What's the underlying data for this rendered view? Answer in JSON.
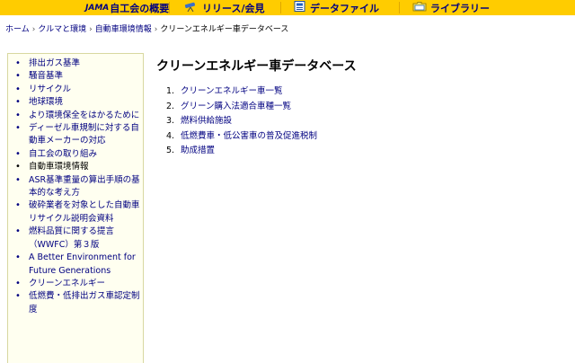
{
  "topnav": {
    "items": [
      {
        "logo": "JAMA",
        "label": "自工会の概要",
        "icon": "jama-logo"
      },
      {
        "label": "リリース/会見",
        "icon": "telescope-icon"
      },
      {
        "label": "データファイル",
        "icon": "document-icon"
      },
      {
        "label": "ライブラリー",
        "icon": "folder-icon"
      }
    ]
  },
  "breadcrumb": {
    "items": [
      "ホーム",
      "クルマと環境",
      "自動車環境情報"
    ],
    "separator": "›",
    "current": "クリーンエネルギー車データベース"
  },
  "sidebar": {
    "bullet": "•",
    "items": [
      {
        "label": "排出ガス基準"
      },
      {
        "label": "騒音基準"
      },
      {
        "label": "リサイクル"
      },
      {
        "label": "地球環境"
      },
      {
        "label": "より環境保全をはかるために"
      },
      {
        "label": "ディーゼル車規制に対する自動車メーカーの対応"
      },
      {
        "label": "自工会の取り組み"
      },
      {
        "label": "自動車環境情報"
      },
      {
        "label": "ASR基準重量の算出手順の基本的な考え方"
      },
      {
        "label": "破砕業者を対象とした自動車リサイクル説明会資料"
      },
      {
        "label": "燃料品質に関する提言（WWFC）第３版"
      },
      {
        "label": "A Better Environment for Future Generations"
      },
      {
        "label": "クリーンエネルギー"
      },
      {
        "label": "低燃費・低排出ガス車認定制度"
      }
    ]
  },
  "main": {
    "title": "クリーンエネルギー車データベース",
    "items": [
      {
        "num": "1.",
        "label": "クリーンエネルギー車一覧"
      },
      {
        "num": "2.",
        "label": "グリーン購入法適合車種一覧"
      },
      {
        "num": "3.",
        "label": "燃料供給施設"
      },
      {
        "num": "4.",
        "label": "低燃費車・低公害車の普及促進税制"
      },
      {
        "num": "5.",
        "label": "助成措置"
      }
    ]
  }
}
